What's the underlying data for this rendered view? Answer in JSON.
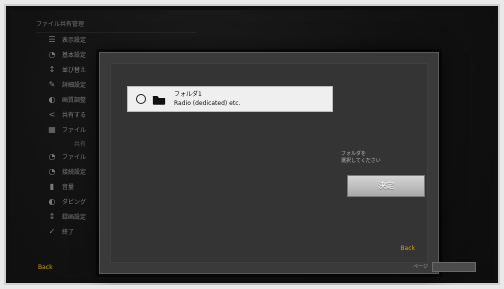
{
  "menu": {
    "header": "ファイル共有管理",
    "items": [
      {
        "icon": "☰",
        "label": "表示設定"
      },
      {
        "icon": "◔",
        "label": "基本設定"
      },
      {
        "icon": "↕",
        "label": "並び替え"
      },
      {
        "icon": "✎",
        "label": "詳細設定"
      },
      {
        "icon": "◐",
        "label": "画質調整"
      },
      {
        "icon": "<",
        "label": "共有する"
      },
      {
        "icon": "▦",
        "label": "ファイル"
      },
      {
        "group": true,
        "label": "共有"
      },
      {
        "icon": "◔",
        "label": "ファイル"
      },
      {
        "icon": "◔",
        "label": "接続設定"
      },
      {
        "icon": "▮",
        "label": "音量"
      },
      {
        "icon": "◐",
        "label": "ダビング"
      },
      {
        "icon": "↕",
        "label": "録画設定"
      },
      {
        "icon": "✓",
        "label": "終了"
      }
    ]
  },
  "dialog": {
    "item": {
      "title": "フォルダ1",
      "subtitle": "Radio (dedicated) etc."
    },
    "hint": "フォルダを\n選択してください",
    "button_label": "決定",
    "back_label": "Back"
  },
  "bottom_bar": {
    "back_label": "Back",
    "page_label": "ページ"
  }
}
